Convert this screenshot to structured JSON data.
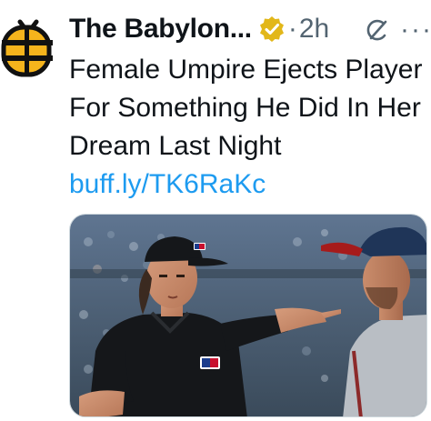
{
  "tweet": {
    "author_name": "The Babylon...",
    "separator": "·",
    "time": "2h",
    "more_label": "···",
    "text_main": "Female Umpire Ejects Player For Something He Did In Her Dream Last Night ",
    "link_text": "buff.ly/TK6RaKc"
  },
  "colors": {
    "link": "#1d9bf0",
    "verified_badge": "#e2b719",
    "muted": "#536471",
    "text": "#0f1419"
  },
  "icons": {
    "avatar": "babylon-bee-logo",
    "badge": "verified-badge-icon",
    "grok": "grok-icon",
    "more": "more-icon"
  },
  "media": {
    "label": "AI-generated image of an umpire pointing at a baseball player"
  }
}
